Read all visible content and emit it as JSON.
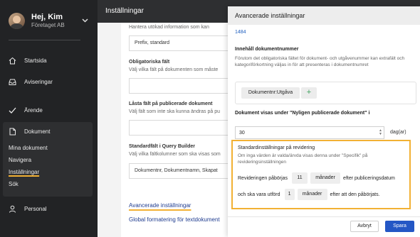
{
  "user": {
    "name": "Hej, Kim",
    "org": "Företaget AB"
  },
  "sidebar": {
    "items": [
      {
        "label": "Startsida",
        "icon": "home-icon"
      },
      {
        "label": "Aviseringar",
        "icon": "inbox-icon"
      },
      {
        "label": "Ärende",
        "icon": "check-icon"
      },
      {
        "label": "Dokument",
        "icon": "document-icon"
      },
      {
        "label": "Personal",
        "icon": "person-icon"
      }
    ],
    "sub_items": [
      "Mina dokument",
      "Navigera",
      "Inställningar",
      "Sök"
    ],
    "active_sub": "Inställningar"
  },
  "main": {
    "title": "Inställningar",
    "lines": [
      "Hantera utökad information som kan",
      "Prefix, standard",
      "Obligatoriska fält",
      "Välj vilka fält på dokumenten som måste",
      "Låsta fält på publicerade dokument",
      "Välj fält som inte ska kunna ändras på pu",
      "Standardfält i Query Builder",
      "Välj vilka fältkolumner som ska visas som",
      "Dokumentnr, Dokumentnamn, Skapat"
    ],
    "link_advanced": "Avancerade inställningar",
    "link_global": "Global formatering för textdokument"
  },
  "modal": {
    "title": "Avancerade inställningar",
    "top_value": "1484",
    "doc_number": {
      "label": "Innehåll dokumentnummer",
      "help": "Förutom det obligatoriska fältet för dokument- och utgåvenummer kan extrafält och kategoriförkortning väljas in för att presenteras i dokumentnumret",
      "tag": "Dokumentnr:Utgåva",
      "add": "+"
    },
    "recent": {
      "label": "Dokument visas under \"Nyligen publicerade dokument\" i",
      "value": "30",
      "unit": "dag(ar)"
    },
    "revision": {
      "label": "Standardinställningar på revidering",
      "help": "Om inga värden är valda/ärvda visas denna under \"Specifik\" på revideringsinställningen",
      "row1_prefix": "Revideringen påbörjas",
      "row1_value": "11",
      "row1_unit": "månader",
      "row1_suffix": "efter publiceringsdatum",
      "row2_prefix": "och ska vara utförd",
      "row2_value": "1",
      "row2_unit": "månader",
      "row2_suffix": "efter att den påbörjats."
    },
    "cancel_label": "Avbryt",
    "save_label": "Spara"
  },
  "colors": {
    "accent": "#2457c5",
    "highlight": "#f2b134",
    "sidebar": "#222325"
  }
}
